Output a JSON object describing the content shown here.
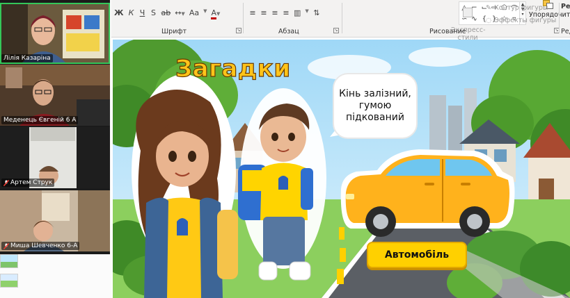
{
  "ribbon": {
    "font_row": [
      "Ж",
      "К",
      "Ч",
      "S",
      "ab",
      "A",
      "Aa",
      "A"
    ],
    "font_group_label": "Шрифт",
    "paragraph_group_label": "Абзац",
    "drawing_group_label": "Рисование",
    "arrange_label": "Упорядочить",
    "quick_styles_label": "Экспресс-\nстили",
    "shape_outline_label": "Контур фигуры",
    "shape_effects_label": "Эффекты фигуры",
    "edit_group_label": "Ред",
    "edit_tab_label": "Ре"
  },
  "participants": [
    {
      "name": "Лілія Казаріна",
      "muted": false,
      "active": true
    },
    {
      "name": "Меденець Євгеній 6 А",
      "muted": false,
      "active": false
    },
    {
      "name": "Артем Струк",
      "muted": true,
      "active": false
    },
    {
      "name": "Миша Шевченко 6-А",
      "muted": true,
      "active": false
    }
  ],
  "slide": {
    "title": "Загадки",
    "riddle": "Кінь залізний,\nгумою\nпідкований",
    "answer_button": "Автомобіль"
  },
  "colors": {
    "title_fill": "#ffc41a",
    "answer_button": "#ffd000",
    "car_body": "#ffb21c",
    "active_speaker_border": "#34c759",
    "flag_blue": "#1b57c4",
    "flag_yellow": "#ffd400"
  }
}
